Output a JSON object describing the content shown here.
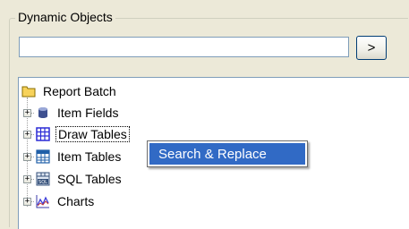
{
  "group": {
    "title": "Dynamic Objects"
  },
  "search": {
    "value": "",
    "button_label": ">"
  },
  "tree": {
    "root": {
      "label": "Report Batch",
      "icon": "folder-icon"
    },
    "items": [
      {
        "label": "Item Fields",
        "icon": "database-icon",
        "selected": false
      },
      {
        "label": "Draw Tables",
        "icon": "grid-table-icon",
        "selected": true
      },
      {
        "label": "Item Tables",
        "icon": "item-table-icon",
        "selected": false
      },
      {
        "label": "SQL Tables",
        "icon": "sql-table-icon",
        "selected": false
      },
      {
        "label": "Charts",
        "icon": "chart-icon",
        "selected": false
      }
    ]
  },
  "context_menu": {
    "items": [
      {
        "label": "Search & Replace",
        "highlighted": true
      }
    ]
  }
}
